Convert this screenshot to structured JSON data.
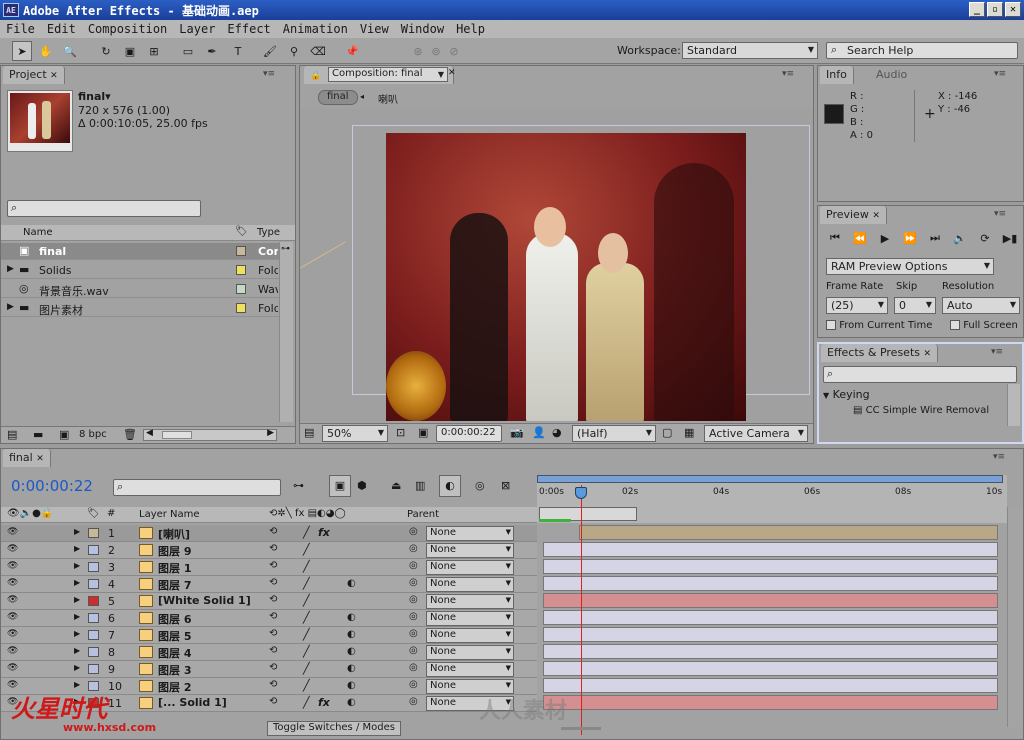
{
  "window": {
    "title": "Adobe After Effects - 基础动画.aep",
    "logo": "AE"
  },
  "menu": [
    "File",
    "Edit",
    "Composition",
    "Layer",
    "Effect",
    "Animation",
    "View",
    "Window",
    "Help"
  ],
  "toolbar": {
    "workspace_label": "Workspace:",
    "workspace_value": "Standard",
    "search_placeholder": "Search Help"
  },
  "project": {
    "tab": "Project",
    "comp_name": "final▾",
    "dims": "720 x 576 (1.00)",
    "duration": "Δ 0:00:10:05, 25.00 fps",
    "col_name": "Name",
    "col_type": "Type",
    "bpc": "8 bpc",
    "items": [
      {
        "name": "final",
        "type": "Com",
        "color": "#c8b89a"
      },
      {
        "name": "Solids",
        "type": "Fold",
        "color": "#f0e060"
      },
      {
        "name": "背景音乐.wav",
        "type": "Wav",
        "color": "#c8d8c8"
      },
      {
        "name": "图片素材",
        "type": "Fold",
        "color": "#f0e060"
      }
    ]
  },
  "composition": {
    "tab": "Composition: final",
    "breadcrumb_active": "final",
    "breadcrumb_next": "喇叭",
    "zoom": "50%",
    "timecode": "0:00:00:22",
    "resolution": "(Half)",
    "camera": "Active Camera"
  },
  "info": {
    "tab": "Info",
    "tab2": "Audio",
    "r": "R :",
    "g": "G :",
    "b": "B :",
    "a": "A : 0",
    "x": "X : -146",
    "y": "Y : -46"
  },
  "preview": {
    "tab": "Preview",
    "ram_options": "RAM Preview Options",
    "frame_rate_label": "Frame Rate",
    "skip_label": "Skip",
    "resolution_label": "Resolution",
    "frame_rate": "(25)",
    "skip": "0",
    "resolution": "Auto",
    "from_current": "From Current Time",
    "full_screen": "Full Screen"
  },
  "effects": {
    "tab": "Effects & Presets",
    "category": "Keying",
    "item": "CC Simple Wire Removal"
  },
  "timeline": {
    "tab": "final",
    "timecode": "0:00:00:22",
    "col_layer_name": "Layer Name",
    "col_parent": "Parent",
    "toggle_label": "Toggle Switches / Modes",
    "ruler": [
      "0:00s",
      "02s",
      "04s",
      "06s",
      "08s",
      "10s"
    ],
    "layers": [
      {
        "num": "1",
        "name": "[喇叭]",
        "color": "#c8b89a",
        "fx": true,
        "bar": "#b8a888",
        "selected": true
      },
      {
        "num": "2",
        "name": "图层 9",
        "color": "#b8c0e0",
        "fx": false,
        "bar": "#d4d4e4"
      },
      {
        "num": "3",
        "name": "图层 1",
        "color": "#b8c0e0",
        "fx": false,
        "bar": "#d4d4e4"
      },
      {
        "num": "4",
        "name": "图层 7",
        "color": "#b8c0e0",
        "fx": false,
        "bar": "#d4d4e4"
      },
      {
        "num": "5",
        "name": "[White Solid 1]",
        "color": "#c83030",
        "fx": false,
        "bar": "#d49090"
      },
      {
        "num": "6",
        "name": "图层 6",
        "color": "#b8c0e0",
        "fx": false,
        "bar": "#d4d4e4"
      },
      {
        "num": "7",
        "name": "图层 5",
        "color": "#b8c0e0",
        "fx": false,
        "bar": "#d4d4e4"
      },
      {
        "num": "8",
        "name": "图层 4",
        "color": "#b8c0e0",
        "fx": false,
        "bar": "#d4d4e4"
      },
      {
        "num": "9",
        "name": "图层 3",
        "color": "#b8c0e0",
        "fx": false,
        "bar": "#d4d4e4"
      },
      {
        "num": "10",
        "name": "图层 2",
        "color": "#b8c0e0",
        "fx": false,
        "bar": "#d4d4e4"
      },
      {
        "num": "11",
        "name": "[... Solid 1]",
        "color": "#c83030",
        "fx": true,
        "bar": "#d49090"
      }
    ],
    "parent_value": "None"
  },
  "watermark": {
    "brand": "火星时代",
    "url": "www.hxsd.com",
    "site": "人人素材"
  }
}
